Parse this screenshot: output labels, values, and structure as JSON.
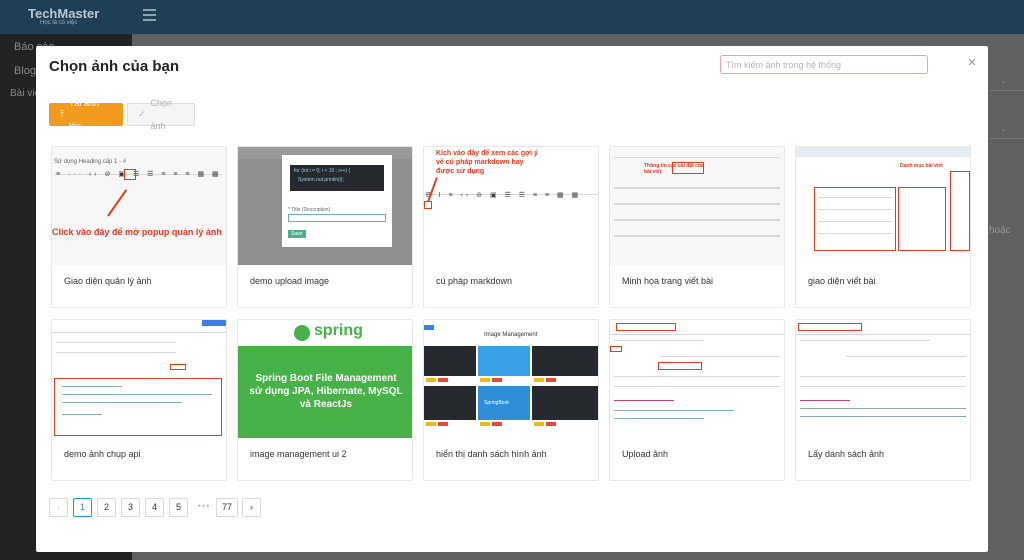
{
  "background": {
    "logo": "TechMaster",
    "logo_sub": "Học là có việc",
    "nav": [
      "Báo cáo",
      "Blog",
      "Bài viết"
    ],
    "hint": "hoặc"
  },
  "modal": {
    "title": "Chọn ảnh của bạn",
    "search_placeholder": "Tìm kiếm ảnh trong hệ thống",
    "close": "×",
    "upload_label": "Tải ảnh lên",
    "choose_label": "Chọn ảnh"
  },
  "images": [
    {
      "caption": "Giao diện quản lý ảnh",
      "annotation": "Click vào đây để mở popup quản lý ảnh",
      "snippet": "Sử dụng Heading cấp 1 - #"
    },
    {
      "caption": "demo upload image",
      "snippet": "for (int i = 0; i < 10 ; i++) {",
      "snippet2": "System.out.println(i);",
      "field_label": "* Title (Description)",
      "save": "Save"
    },
    {
      "caption": "cú pháp markdown",
      "annotation": "Kích vào đây để xem các gợi ý về cú pháp markdown hay được sử dụng"
    },
    {
      "caption": "Minh họa trang viết bài",
      "annotation": "Thông tin các cài đặt của bài viết"
    },
    {
      "caption": "giao diện viết bài",
      "annotation": "Danh mục bài viết"
    },
    {
      "caption": "demo ảnh chụp api"
    },
    {
      "caption": "image management ui 2",
      "logo": "spring",
      "title": "Spring Boot File Management sử dụng JPA, Hibernate, MySQL và ReactJs"
    },
    {
      "caption": "hiển thị danh sách hình ảnh",
      "heading": "Image Management",
      "badge": "SpringBoot"
    },
    {
      "caption": "Upload ảnh"
    },
    {
      "caption": "Lấy danh sách ảnh"
    }
  ],
  "pagination": {
    "prev": "‹",
    "pages": [
      "1",
      "2",
      "3",
      "4",
      "5"
    ],
    "ellipsis": "•••",
    "last": "77",
    "next": "›",
    "current": "1"
  },
  "colors": {
    "primary": "#f19a1e",
    "accent": "#1890ff",
    "annotation": "#e63a1f",
    "spring_green": "#47b248"
  }
}
